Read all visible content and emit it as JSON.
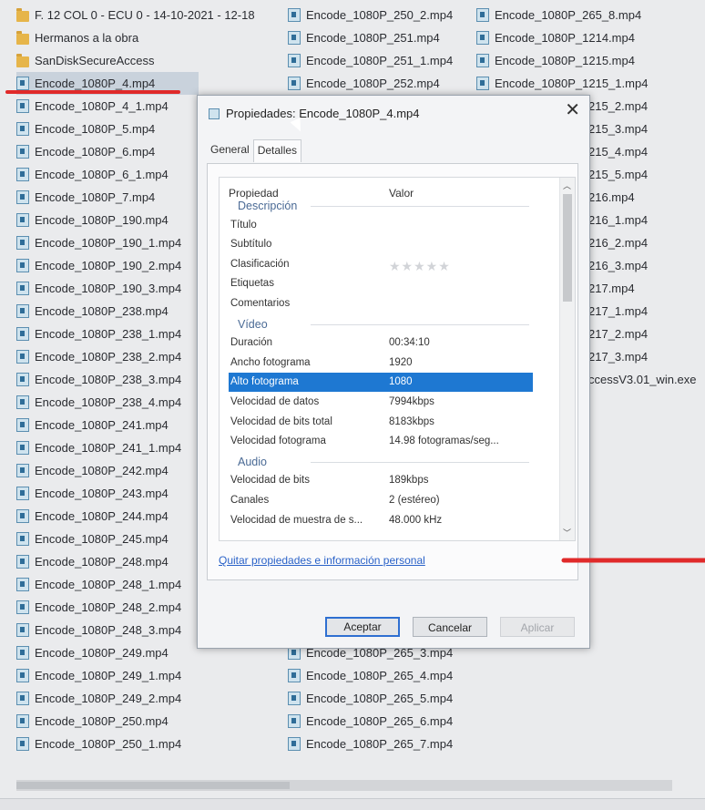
{
  "explorer": {
    "column1": [
      {
        "name": "F. 12 COL 0 - ECU 0 - 14-10-2021 - 12-18",
        "type": "folder"
      },
      {
        "name": "Hermanos a la obra",
        "type": "folder"
      },
      {
        "name": "SanDiskSecureAccess",
        "type": "folder"
      },
      {
        "name": "Encode_1080P_4.mp4",
        "type": "video",
        "selected": true
      },
      {
        "name": "Encode_1080P_4_1.mp4",
        "type": "video"
      },
      {
        "name": "Encode_1080P_5.mp4",
        "type": "video"
      },
      {
        "name": "Encode_1080P_6.mp4",
        "type": "video"
      },
      {
        "name": "Encode_1080P_6_1.mp4",
        "type": "video"
      },
      {
        "name": "Encode_1080P_7.mp4",
        "type": "video"
      },
      {
        "name": "Encode_1080P_190.mp4",
        "type": "video"
      },
      {
        "name": "Encode_1080P_190_1.mp4",
        "type": "video"
      },
      {
        "name": "Encode_1080P_190_2.mp4",
        "type": "video"
      },
      {
        "name": "Encode_1080P_190_3.mp4",
        "type": "video"
      },
      {
        "name": "Encode_1080P_238.mp4",
        "type": "video"
      },
      {
        "name": "Encode_1080P_238_1.mp4",
        "type": "video"
      },
      {
        "name": "Encode_1080P_238_2.mp4",
        "type": "video"
      },
      {
        "name": "Encode_1080P_238_3.mp4",
        "type": "video"
      },
      {
        "name": "Encode_1080P_238_4.mp4",
        "type": "video"
      },
      {
        "name": "Encode_1080P_241.mp4",
        "type": "video"
      },
      {
        "name": "Encode_1080P_241_1.mp4",
        "type": "video"
      },
      {
        "name": "Encode_1080P_242.mp4",
        "type": "video"
      },
      {
        "name": "Encode_1080P_243.mp4",
        "type": "video"
      },
      {
        "name": "Encode_1080P_244.mp4",
        "type": "video"
      },
      {
        "name": "Encode_1080P_245.mp4",
        "type": "video"
      },
      {
        "name": "Encode_1080P_248.mp4",
        "type": "video"
      },
      {
        "name": "Encode_1080P_248_1.mp4",
        "type": "video"
      },
      {
        "name": "Encode_1080P_248_2.mp4",
        "type": "video"
      },
      {
        "name": "Encode_1080P_248_3.mp4",
        "type": "video"
      },
      {
        "name": "Encode_1080P_249.mp4",
        "type": "video"
      },
      {
        "name": "Encode_1080P_249_1.mp4",
        "type": "video"
      },
      {
        "name": "Encode_1080P_249_2.mp4",
        "type": "video"
      },
      {
        "name": "Encode_1080P_250.mp4",
        "type": "video"
      },
      {
        "name": "Encode_1080P_250_1.mp4",
        "type": "video"
      }
    ],
    "column2": [
      {
        "name": "Encode_1080P_250_2.mp4",
        "row": 0
      },
      {
        "name": "Encode_1080P_251.mp4",
        "row": 1
      },
      {
        "name": "Encode_1080P_251_1.mp4",
        "row": 2
      },
      {
        "name": "Encode_1080P_252.mp4",
        "row": 3
      },
      {
        "name": "Encode_1080P_265_3.mp4",
        "row": 28
      },
      {
        "name": "Encode_1080P_265_4.mp4",
        "row": 29
      },
      {
        "name": "Encode_1080P_265_5.mp4",
        "row": 30
      },
      {
        "name": "Encode_1080P_265_6.mp4",
        "row": 31
      },
      {
        "name": "Encode_1080P_265_7.mp4",
        "row": 32
      }
    ],
    "column3": [
      {
        "name": "Encode_1080P_265_8.mp4",
        "row": 0
      },
      {
        "name": "Encode_1080P_1214.mp4",
        "row": 1
      },
      {
        "name": "Encode_1080P_1215.mp4",
        "row": 2
      },
      {
        "name": "Encode_1080P_1215_1.mp4",
        "row": 3
      }
    ],
    "column3_fragments": [
      {
        "name": "215_2.mp4",
        "row": 4
      },
      {
        "name": "215_3.mp4",
        "row": 5
      },
      {
        "name": "215_4.mp4",
        "row": 6
      },
      {
        "name": "215_5.mp4",
        "row": 7
      },
      {
        "name": "216.mp4",
        "row": 8
      },
      {
        "name": "216_1.mp4",
        "row": 9
      },
      {
        "name": "216_2.mp4",
        "row": 10
      },
      {
        "name": "216_3.mp4",
        "row": 11
      },
      {
        "name": "217.mp4",
        "row": 12
      },
      {
        "name": "217_1.mp4",
        "row": 13
      },
      {
        "name": "217_2.mp4",
        "row": 14
      },
      {
        "name": "217_3.mp4",
        "row": 15
      },
      {
        "name": "ccessV3.01_win.exe",
        "row": 16
      }
    ]
  },
  "dialog": {
    "title": "Propiedades: Encode_1080P_4.mp4",
    "close": "✕",
    "tabs": [
      "General",
      "Detalles"
    ],
    "header": {
      "property": "Propiedad",
      "value": "Valor"
    },
    "rows": [
      {
        "kind": "group",
        "label": "Descripción"
      },
      {
        "kind": "item",
        "label": "Título",
        "value": ""
      },
      {
        "kind": "item",
        "label": "Subtítulo",
        "value": ""
      },
      {
        "kind": "item",
        "label": "Clasificación",
        "value": "",
        "stars": "★★★★★"
      },
      {
        "kind": "item",
        "label": "Etiquetas",
        "value": ""
      },
      {
        "kind": "item",
        "label": "Comentarios",
        "value": ""
      },
      {
        "kind": "group",
        "label": "Vídeo"
      },
      {
        "kind": "item",
        "label": "Duración",
        "value": "00:34:10"
      },
      {
        "kind": "item",
        "label": "Ancho fotograma",
        "value": "1920"
      },
      {
        "kind": "item",
        "label": "Alto fotograma",
        "value": "1080",
        "selected": true
      },
      {
        "kind": "item",
        "label": "Velocidad de datos",
        "value": "7994kbps"
      },
      {
        "kind": "item",
        "label": "Velocidad de bits total",
        "value": "8183kbps"
      },
      {
        "kind": "item",
        "label": "Velocidad fotograma",
        "value": "14.98 fotogramas/seg..."
      },
      {
        "kind": "group",
        "label": "Audio"
      },
      {
        "kind": "item",
        "label": "Velocidad de bits",
        "value": "189kbps"
      },
      {
        "kind": "item",
        "label": "Canales",
        "value": "2 (estéreo)"
      },
      {
        "kind": "item",
        "label": "Velocidad de muestra de s...",
        "value": "48.000 kHz"
      }
    ],
    "link": "Quitar propiedades e información personal",
    "buttons": {
      "ok": "Aceptar",
      "cancel": "Cancelar",
      "apply": "Aplicar"
    }
  },
  "colors": {
    "accent": "#1e78d2",
    "annotation": "#e02a2a"
  }
}
